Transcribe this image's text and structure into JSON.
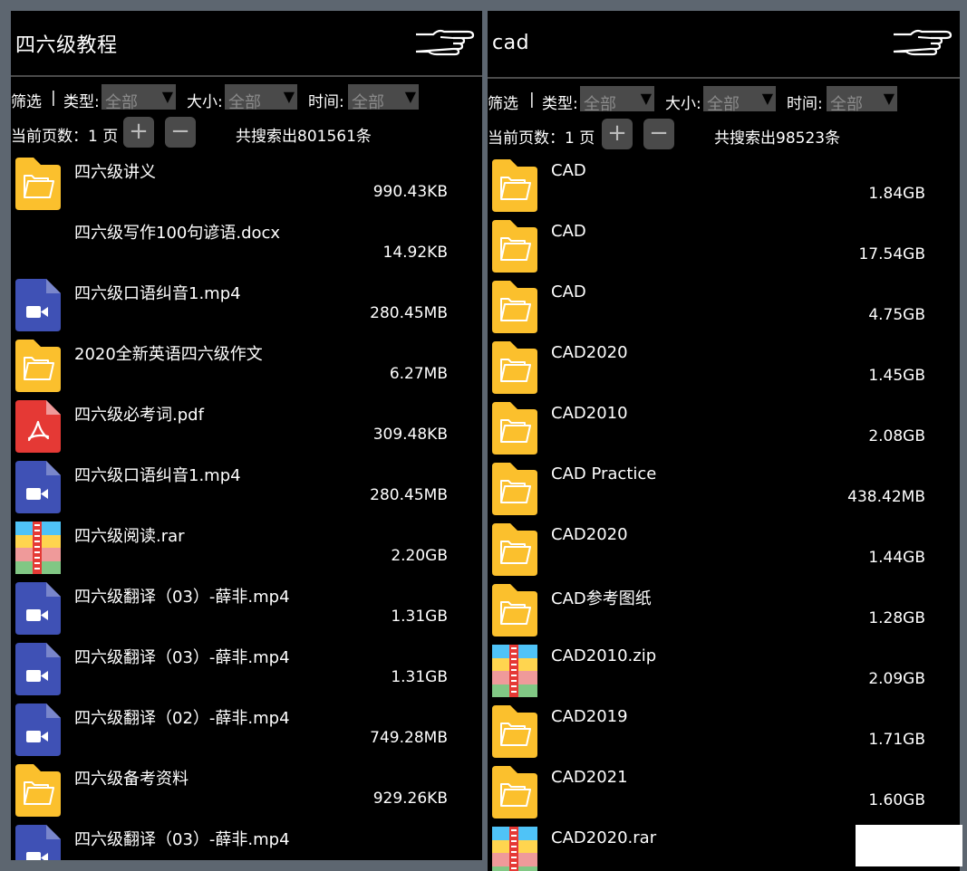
{
  "left": {
    "title": "四六级教程",
    "filters": {
      "filter": "筛选",
      "sep": "|",
      "type_label": "类型:",
      "type_value": "全部",
      "size_label": "大小:",
      "size_value": "全部",
      "time_label": "时间:",
      "time_value": "全部"
    },
    "pager": {
      "label": "当前页数：1 页",
      "plus": "+",
      "minus": "−",
      "count": "共搜索出801561条"
    },
    "items": [
      {
        "icon": "folder-icon",
        "name": "四六级讲义",
        "size": "990.43KB"
      },
      {
        "icon": "none",
        "name": "四六级写作100句谚语.docx",
        "size": "14.92KB"
      },
      {
        "icon": "video-file-icon",
        "name": "四六级口语纠音1.mp4",
        "size": "280.45MB"
      },
      {
        "icon": "folder-icon",
        "name": "2020全新英语四六级作文",
        "size": "6.27MB"
      },
      {
        "icon": "pdf-file-icon",
        "name": "四六级必考词.pdf",
        "size": "309.48KB"
      },
      {
        "icon": "video-file-icon",
        "name": "四六级口语纠音1.mp4",
        "size": "280.45MB"
      },
      {
        "icon": "archive-file-icon",
        "name": "四六级阅读.rar",
        "size": "2.20GB"
      },
      {
        "icon": "video-file-icon",
        "name": "四六级翻译（03）-薛非.mp4",
        "size": "1.31GB"
      },
      {
        "icon": "video-file-icon",
        "name": "四六级翻译（03）-薛非.mp4",
        "size": "1.31GB"
      },
      {
        "icon": "video-file-icon",
        "name": "四六级翻译（02）-薛非.mp4",
        "size": "749.28MB"
      },
      {
        "icon": "folder-icon",
        "name": "四六级备考资料",
        "size": "929.26KB"
      },
      {
        "icon": "video-file-icon",
        "name": "四六级翻译（03）-薛非.mp4",
        "size": ""
      }
    ]
  },
  "right": {
    "title": "cad",
    "filters": {
      "filter": "筛选",
      "sep": "|",
      "type_label": "类型:",
      "type_value": "全部",
      "size_label": "大小:",
      "size_value": "全部",
      "time_label": "时间:",
      "time_value": "全部"
    },
    "pager": {
      "label": "当前页数：1 页",
      "plus": "+",
      "minus": "−",
      "count": "共搜索出98523条"
    },
    "items": [
      {
        "icon": "folder-icon",
        "name": "CAD",
        "size": "1.84GB"
      },
      {
        "icon": "folder-icon",
        "name": "CAD",
        "size": "17.54GB"
      },
      {
        "icon": "folder-icon",
        "name": "CAD",
        "size": "4.75GB"
      },
      {
        "icon": "folder-icon",
        "name": "CAD2020",
        "size": "1.45GB"
      },
      {
        "icon": "folder-icon",
        "name": "CAD2010",
        "size": "2.08GB"
      },
      {
        "icon": "folder-icon",
        "name": "CAD Practice",
        "size": "438.42MB"
      },
      {
        "icon": "folder-icon",
        "name": "CAD2020",
        "size": "1.44GB"
      },
      {
        "icon": "folder-icon",
        "name": "CAD参考图纸",
        "size": "1.28GB"
      },
      {
        "icon": "archive-file-icon",
        "name": "CAD2010.zip",
        "size": "2.09GB"
      },
      {
        "icon": "folder-icon",
        "name": "CAD2019",
        "size": "1.71GB"
      },
      {
        "icon": "folder-icon",
        "name": "CAD2021",
        "size": "1.60GB"
      },
      {
        "icon": "archive-file-icon",
        "name": "CAD2020.rar",
        "size": ""
      }
    ]
  },
  "colors": {
    "folder": "#fbc02d",
    "video": "#3f51b5",
    "pdf": "#e53935",
    "background": "#000000",
    "control": "#4a4a4a"
  }
}
